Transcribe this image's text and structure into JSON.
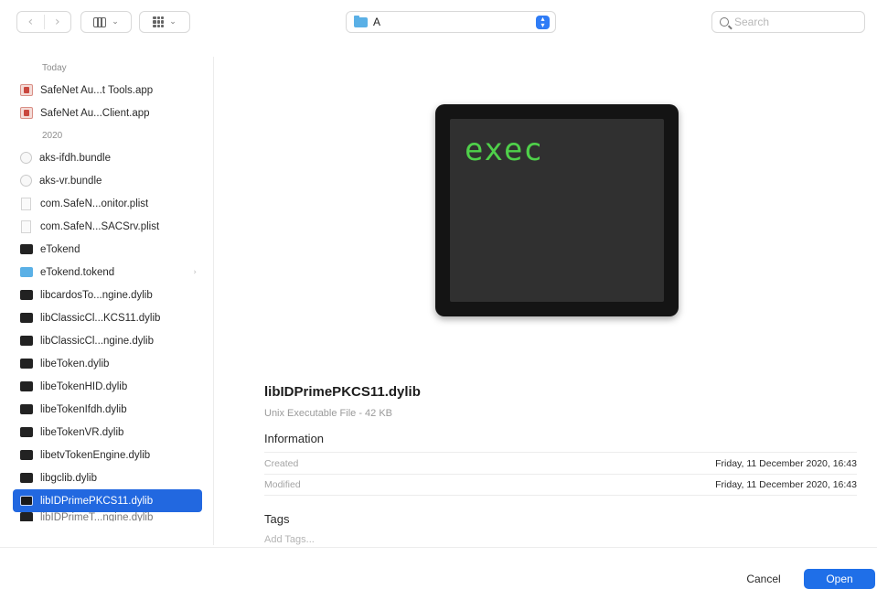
{
  "toolbar": {
    "back_glyph": "‹",
    "forward_glyph": "›",
    "view_chevron": "⌄",
    "location": "A",
    "location_stepper": "⌃⌄",
    "search_placeholder": "Search"
  },
  "sidebar": {
    "groups": [
      {
        "heading": "Today",
        "items": [
          {
            "label": "SafeNet Au...t Tools.app",
            "icon": "app-icon"
          },
          {
            "label": "SafeNet Au...Client.app",
            "icon": "app-icon"
          }
        ]
      },
      {
        "heading": "2020",
        "items": [
          {
            "label": "aks-ifdh.bundle",
            "icon": "bundle-icon"
          },
          {
            "label": "aks-vr.bundle",
            "icon": "bundle-icon"
          },
          {
            "label": "com.SafeN...onitor.plist",
            "icon": "plist-icon"
          },
          {
            "label": "com.SafeN...SACSrv.plist",
            "icon": "plist-icon"
          },
          {
            "label": "eTokend",
            "icon": "executable-icon"
          },
          {
            "label": "eTokend.tokend",
            "icon": "folder-icon",
            "disclosure": "›"
          },
          {
            "label": "libcardosTo...ngine.dylib",
            "icon": "executable-icon"
          },
          {
            "label": "libClassicCl...KCS11.dylib",
            "icon": "executable-icon"
          },
          {
            "label": "libClassicCl...ngine.dylib",
            "icon": "executable-icon"
          },
          {
            "label": "libeToken.dylib",
            "icon": "executable-icon"
          },
          {
            "label": "libeTokenHID.dylib",
            "icon": "executable-icon"
          },
          {
            "label": "libeTokenIfdh.dylib",
            "icon": "executable-icon"
          },
          {
            "label": "libeTokenVR.dylib",
            "icon": "executable-icon"
          },
          {
            "label": "libetvTokenEngine.dylib",
            "icon": "executable-icon"
          },
          {
            "label": "libgclib.dylib",
            "icon": "executable-icon"
          },
          {
            "label": "libIDPrimePKCS11.dylib",
            "icon": "executable-icon",
            "selected": true
          },
          {
            "label": "libIDPrimeT...ngine.dylib",
            "icon": "executable-icon",
            "partial": true
          }
        ]
      }
    ]
  },
  "preview": {
    "icon_text": "exec",
    "file_name": "libIDPrimePKCS11.dylib",
    "file_kind": "Unix Executable File - 42 KB",
    "information_heading": "Information",
    "created_label": "Created",
    "created_value": "Friday, 11 December 2020, 16:43",
    "modified_label": "Modified",
    "modified_value": "Friday, 11 December 2020, 16:43",
    "tags_heading": "Tags",
    "tags_placeholder": "Add Tags..."
  },
  "footer": {
    "cancel_label": "Cancel",
    "open_label": "Open"
  }
}
